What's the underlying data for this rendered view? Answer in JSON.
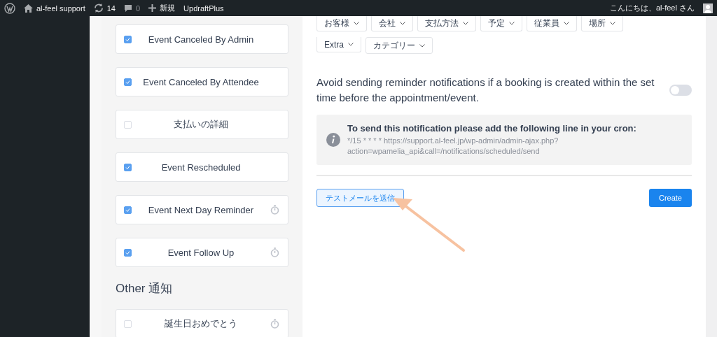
{
  "admin_bar": {
    "site": "al-feel support",
    "updates": "14",
    "comments": "0",
    "new": "新規",
    "plugin": "UpdraftPlus",
    "greeting": "こんにちは、al-feel さん"
  },
  "notifications": [
    {
      "label": "Event Canceled By Admin",
      "checked": true,
      "scheduled": false
    },
    {
      "label": "Event Canceled By Attendee",
      "checked": true,
      "scheduled": false
    },
    {
      "label": "支払いの詳細",
      "checked": false,
      "scheduled": false
    },
    {
      "label": "Event Rescheduled",
      "checked": true,
      "scheduled": false
    },
    {
      "label": "Event Next Day Reminder",
      "checked": true,
      "scheduled": true
    },
    {
      "label": "Event Follow Up",
      "checked": true,
      "scheduled": true
    }
  ],
  "other_heading": "Other 通知",
  "other_notifications": [
    {
      "label": "誕生日おめでとう",
      "checked": false,
      "scheduled": true
    }
  ],
  "placeholder_groups": [
    {
      "label": "お客様"
    },
    {
      "label": "会社"
    },
    {
      "label": "支払方法"
    },
    {
      "label": "予定"
    },
    {
      "label": "従業員"
    },
    {
      "label": "場所"
    },
    {
      "label": "Extra"
    },
    {
      "label": "カテゴリー"
    }
  ],
  "reminder_setting": {
    "text": "Avoid sending reminder notifications if a booking is created within the set time before the appointment/event.",
    "on": false
  },
  "cron_notice": {
    "title": "To send this notification please add the following line in your cron:",
    "lines": [
      "*/15 * * * * https://support.al-feel.jp/wp-admin/admin-ajax.php?",
      "action=wpamelia_api&call=/notifications/scheduled/send"
    ]
  },
  "buttons": {
    "test": "テストメールを送信",
    "create": "Create"
  }
}
